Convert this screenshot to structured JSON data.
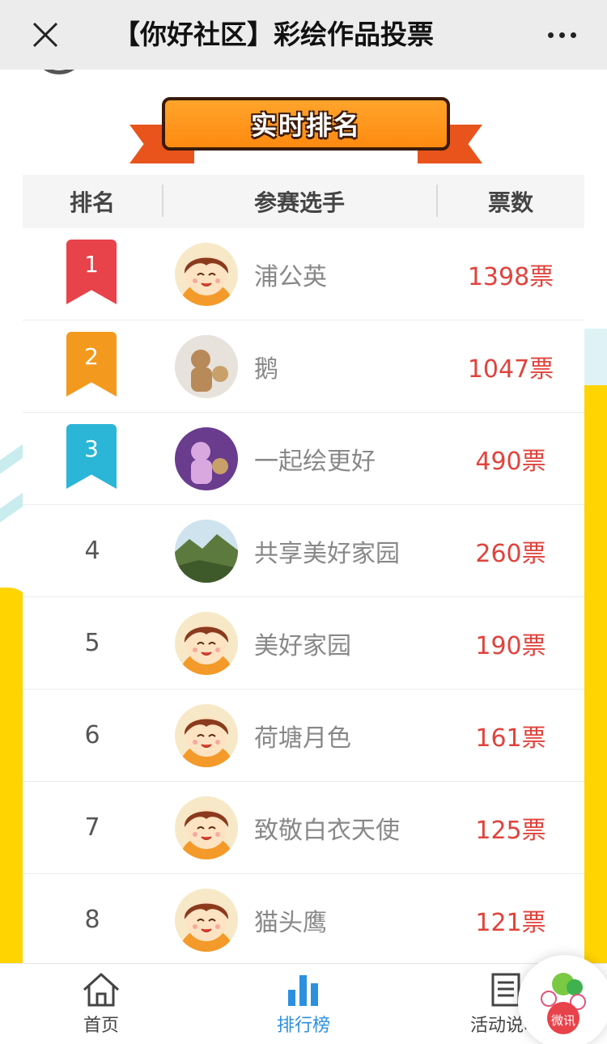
{
  "titlebar": {
    "title": "【你好社区】彩绘作品投票"
  },
  "banner": {
    "text": "实时排名"
  },
  "table": {
    "headers": {
      "rank": "排名",
      "player": "参赛选手",
      "votes": "票数"
    },
    "rows": [
      {
        "rank": "1",
        "name": "浦公英",
        "votes": "1398票",
        "badge_color": "#e8424a"
      },
      {
        "rank": "2",
        "name": "鹅",
        "votes": "1047票",
        "badge_color": "#f39a1e"
      },
      {
        "rank": "3",
        "name": "一起绘更好",
        "votes": "490票",
        "badge_color": "#2bb5d6"
      },
      {
        "rank": "4",
        "name": "共享美好家园",
        "votes": "260票"
      },
      {
        "rank": "5",
        "name": "美好家园",
        "votes": "190票"
      },
      {
        "rank": "6",
        "name": "荷塘月色",
        "votes": "161票"
      },
      {
        "rank": "7",
        "name": "致敬白衣天使",
        "votes": "125票"
      },
      {
        "rank": "8",
        "name": "猫头鹰",
        "votes": "121票"
      }
    ]
  },
  "tabbar": {
    "home": "首页",
    "ranking": "排行榜",
    "activity": "活动说明"
  },
  "fab": {
    "label": "微讯"
  },
  "colors": {
    "accent": "#2d8fe0",
    "votes": "#e0433c",
    "banner": "#ff8a10",
    "yellow": "#ffd400"
  }
}
